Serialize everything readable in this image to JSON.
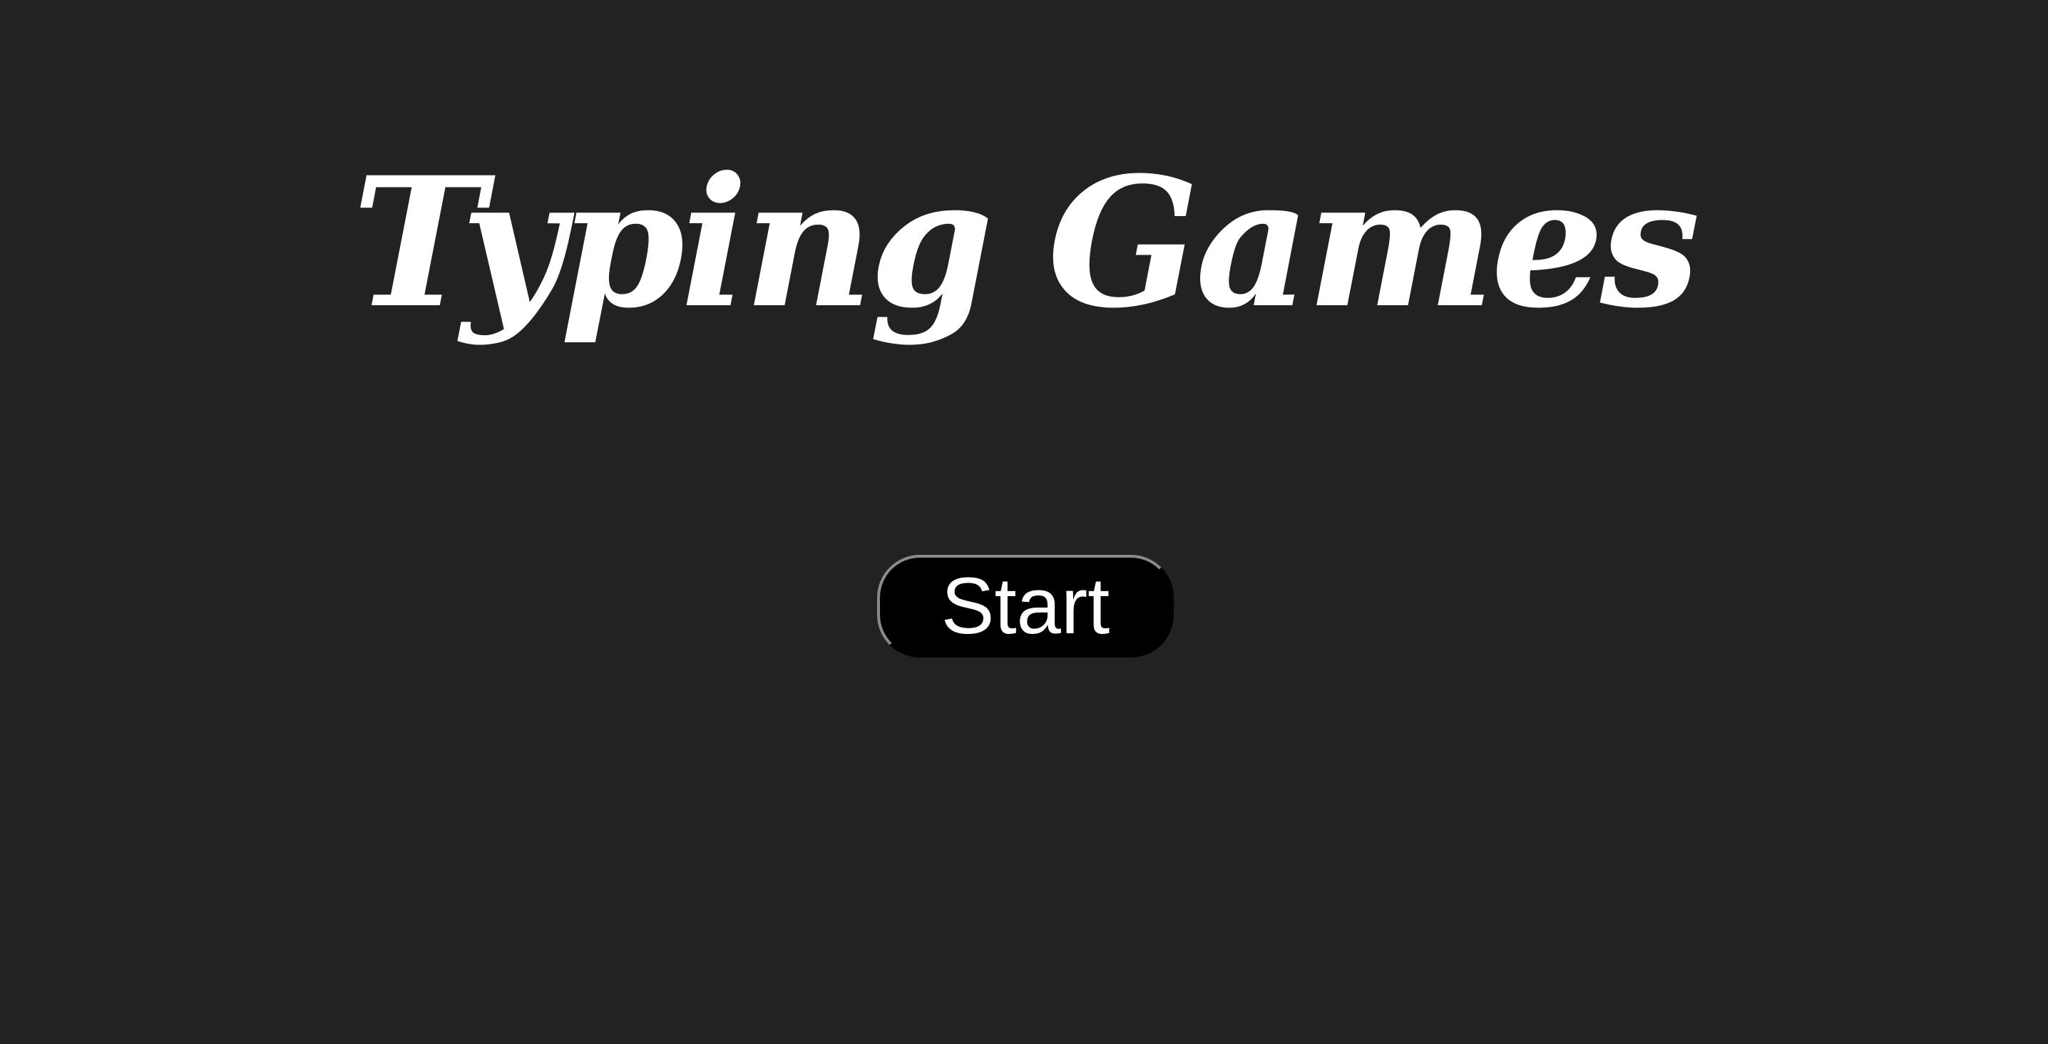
{
  "title": "Typing Games",
  "start_button": {
    "label": "Start"
  },
  "colors": {
    "background": "#222222",
    "text": "#ffffff",
    "button_background": "#000000"
  }
}
